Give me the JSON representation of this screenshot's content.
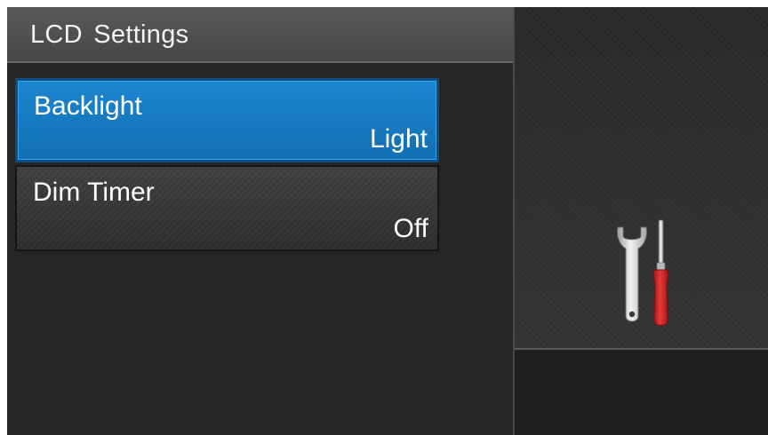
{
  "header": {
    "title": "LCD  Settings"
  },
  "menu": {
    "items": [
      {
        "label": "Backlight",
        "value": "Light",
        "selected": true
      },
      {
        "label": "Dim Timer",
        "value": "Off",
        "selected": false
      }
    ]
  },
  "icons": {
    "settings": "wrench-screwdriver-icon"
  },
  "colors": {
    "selected_item": "#1b86cf",
    "screwdriver_handle": "#d21f1f",
    "wrench": "#d0d0d0"
  }
}
